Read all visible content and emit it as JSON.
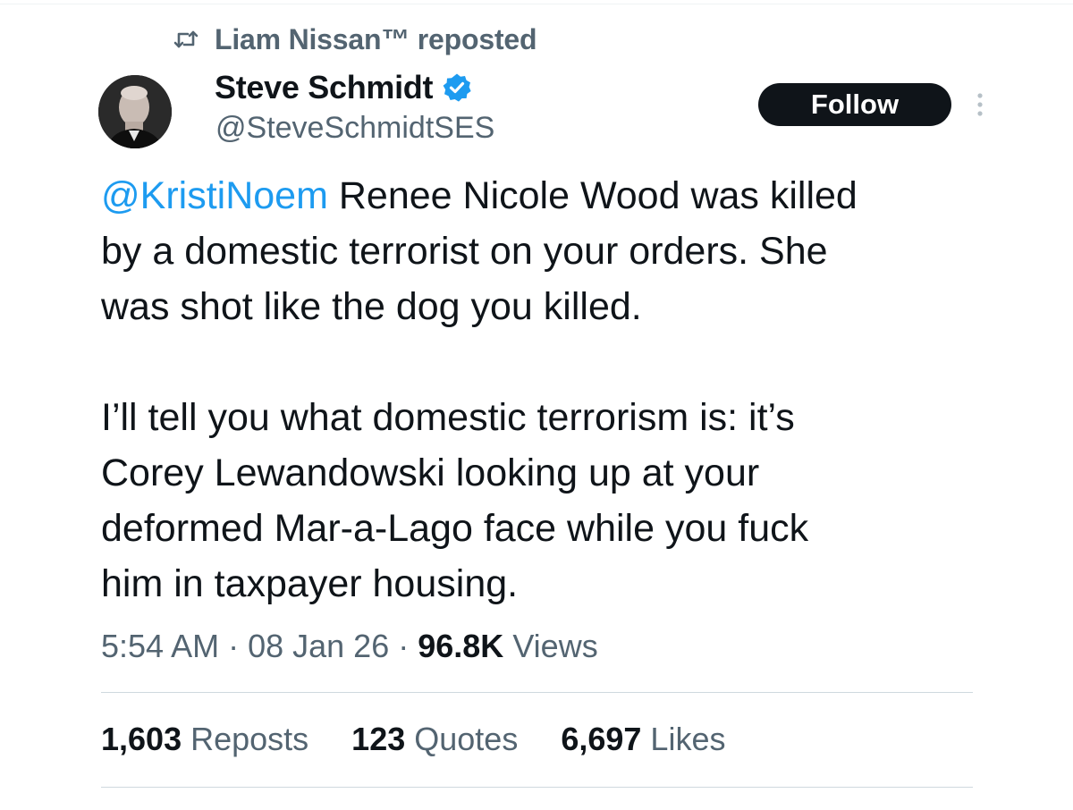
{
  "repost_banner": {
    "text": "Liam Nissan™ reposted",
    "icon": "repost-icon"
  },
  "author": {
    "name": "Steve Schmidt",
    "handle": "@SteveSchmidtSES",
    "verified": true,
    "verified_color": "#1d9bf0"
  },
  "follow_label": "Follow",
  "tweet": {
    "line1_mention": "@KristiNoem",
    "line1_rest": " Renee Nicole Wood was killed",
    "line2": "by a domestic terrorist on your orders. She",
    "line3": "was shot like the dog you killed.",
    "line4": "I’ll tell you what domestic terrorism is: it’s",
    "line5": "Corey Lewandowski looking up at your",
    "line6": "deformed Mar-a-Lago face while you fuck",
    "line7": "him in taxpayer housing."
  },
  "meta": {
    "time": "5:54 AM",
    "sep1": " · ",
    "date": "08 Jan 26",
    "sep2": " · ",
    "views_count": "96.8K",
    "views_label": " Views"
  },
  "stats": {
    "reposts_count": "1,603",
    "reposts_label": " Reposts",
    "quotes_count": "123",
    "quotes_label": " Quotes",
    "likes_count": "6,697",
    "likes_label": " Likes"
  },
  "colors": {
    "accent": "#1d9bf0",
    "text_primary": "#0f1419",
    "text_secondary": "#536471"
  }
}
